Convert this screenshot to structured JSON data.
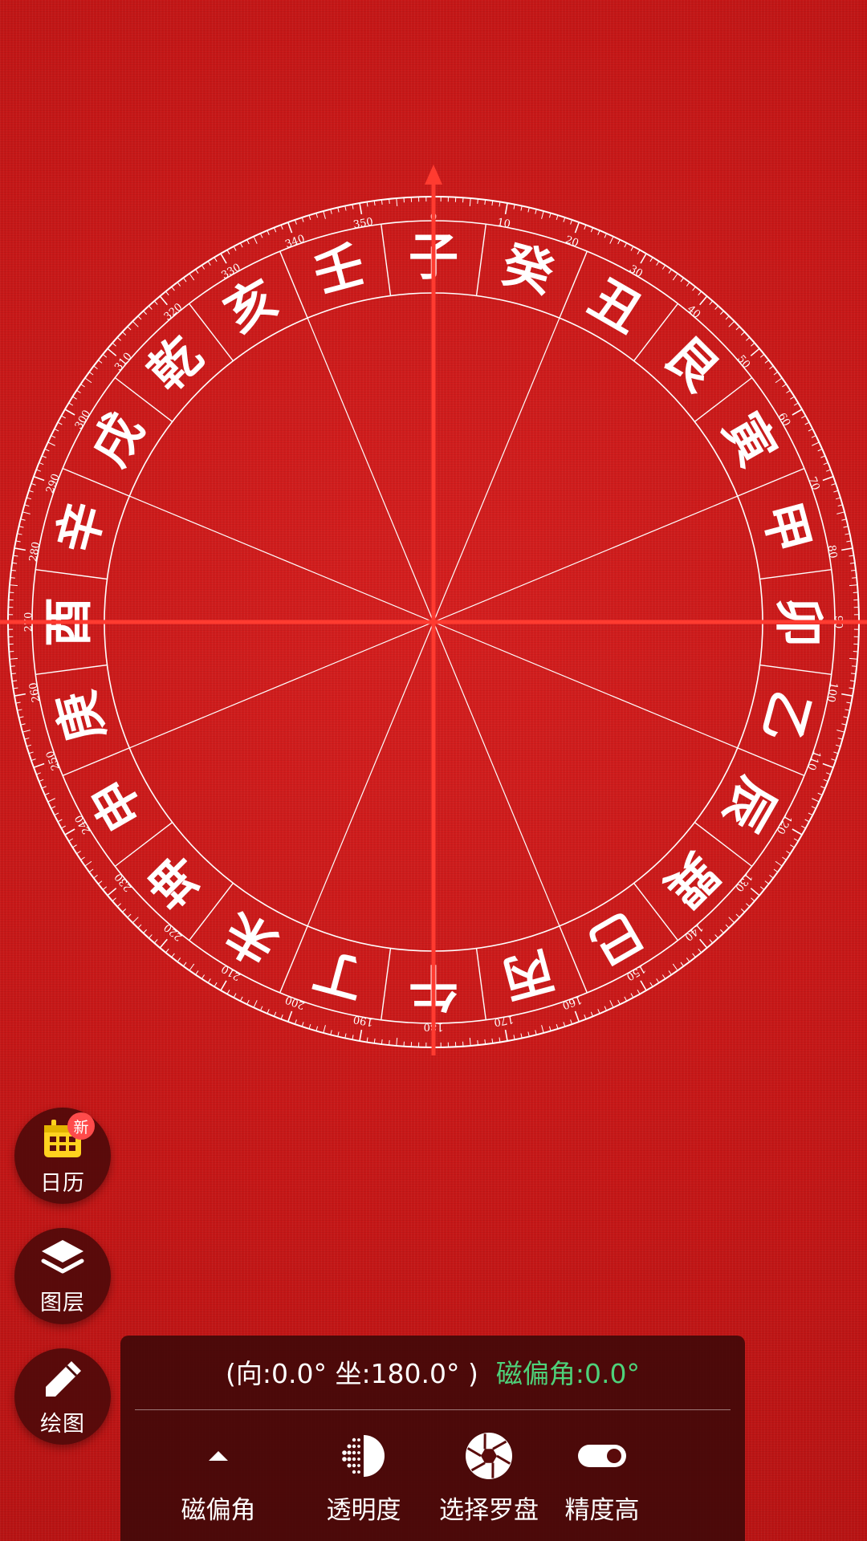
{
  "compass": {
    "ring_labels": [
      "子",
      "癸",
      "丑",
      "艮",
      "寅",
      "甲",
      "卯",
      "乙",
      "辰",
      "巽",
      "巳",
      "丙",
      "午",
      "丁",
      "未",
      "坤",
      "申",
      "庚",
      "酉",
      "辛",
      "戌",
      "乾",
      "亥",
      "壬"
    ],
    "degree_labels": [
      "0",
      "10",
      "20",
      "30",
      "40",
      "50",
      "60",
      "70",
      "80",
      "90",
      "100",
      "110",
      "120",
      "130",
      "140",
      "150",
      "160",
      "170",
      "180",
      "190",
      "200",
      "210",
      "220",
      "230",
      "240",
      "250",
      "260",
      "270",
      "280",
      "290",
      "300",
      "310",
      "320",
      "330",
      "340",
      "350"
    ],
    "colors": {
      "ring_text": "#ffffff",
      "crosshair": "#ff3b30",
      "lines": "#ffffff"
    }
  },
  "fab": {
    "calendar": {
      "label": "日历",
      "badge": "新",
      "icon": "calendar-icon"
    },
    "layers": {
      "label": "图层",
      "icon": "layers-icon"
    },
    "draw": {
      "label": "绘图",
      "icon": "pencil-icon"
    }
  },
  "panel": {
    "readout_main": "(向:0.0°  坐:180.0° )",
    "readout_declination": "磁偏角:0.0°",
    "tools": [
      {
        "label": "磁偏角",
        "icon": "caret-up-icon"
      },
      {
        "label": "透明度",
        "icon": "opacity-icon"
      },
      {
        "label": "选择罗盘",
        "icon": "aperture-icon"
      },
      {
        "label": "精度高",
        "icon": "toggle-icon"
      }
    ],
    "colors": {
      "declination": "#4ed27a",
      "panel_bg": "#3c0808"
    }
  }
}
